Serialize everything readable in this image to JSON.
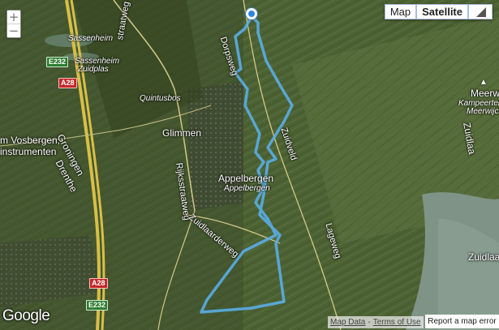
{
  "map_type": {
    "map_label": "Map",
    "satellite_label": "Satellite",
    "selected": "Satellite"
  },
  "zoom": {
    "in": "+",
    "out": "−"
  },
  "colors": {
    "route": "#5aaee6",
    "terrain_dark": "#2f3d22",
    "terrain_mid": "#4a5c34",
    "field": "#556b3a",
    "water": "#7f9486",
    "highway": "#e0c24a"
  },
  "labels": {
    "sassenheim": "Sassenheim",
    "sassenheim_zuidplas_1": "Sassenheim",
    "sassenheim_zuidplas_2": "Zuidplas",
    "dorpsweg": "Dorpsweg",
    "straatweg": "straatweg",
    "quintusbos": "Quintusbos",
    "glimmen": "Glimmen",
    "vosbergen_1": "m Vosbergen,",
    "vosbergen_2": "instrumenten",
    "groningen": "Groningen",
    "drenthe": "Drenthe",
    "appelbergen": "Appelbergen",
    "appelbergen_small": "Appelbergen",
    "zuidveld": "Zuidveld",
    "rijksstraatweg": "Rijksstraatweg",
    "zuidlaarderweg": "Zuidlaarderweg",
    "lageweg": "Lageweg",
    "meerwijck": "Meerwijck",
    "kampeerterrein_1": "Kampeerterrein-Ja",
    "kampeerterrein_2": "Meerwijck",
    "zuidlaa": "Zuidlaa",
    "zuidlaa_small": "Zuidlaa"
  },
  "road_shields": {
    "e232_top": "E232",
    "a28_top": "A28",
    "a28_bottom": "A28",
    "e232_bottom": "E232"
  },
  "branding": {
    "logo": "Google"
  },
  "footer": {
    "map_data": "Map Data",
    "separator": "-",
    "terms": "Terms of Use",
    "report": "Report a map error"
  },
  "icons": {
    "start_marker": "start-marker-icon",
    "fullscreen": "fullscreen-icon",
    "campsite": "campsite-icon"
  }
}
